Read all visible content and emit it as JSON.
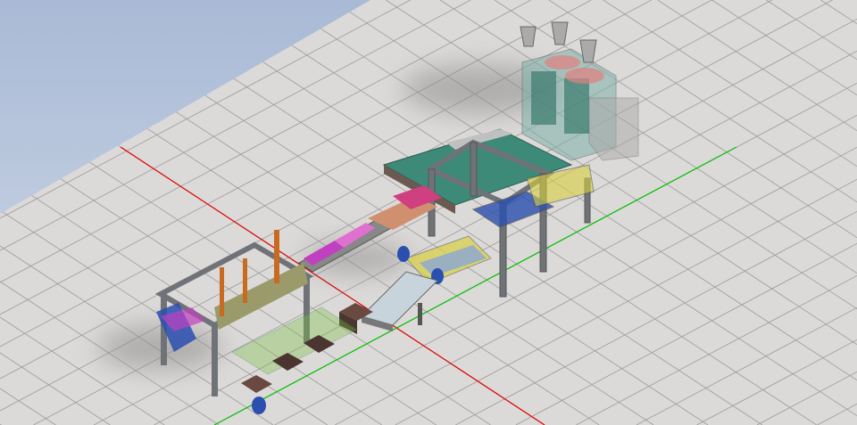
{
  "viewport": {
    "background_top": "#a9bad6",
    "background_bottom": "#d3dbe8",
    "ground_color": "#dcdad8",
    "grid_color": "#9b9b9b",
    "axis_x_color": "#e00000",
    "axis_y_color": "#00c000"
  },
  "palette": {
    "frame": "#6f7377",
    "magenta": "#c040c0",
    "olive": "#9a9a6a",
    "teal": "#3f8f7c",
    "blue": "#2a4fb0",
    "yellow": "#d8d040",
    "brown": "#6a4a40",
    "glass": "#9ec8c0"
  }
}
